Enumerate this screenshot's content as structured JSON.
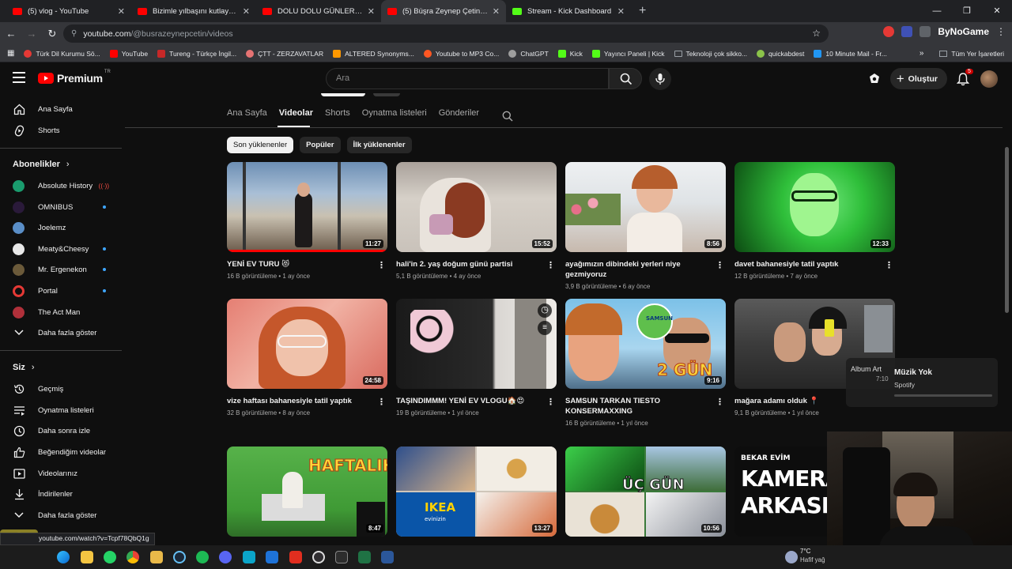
{
  "browser": {
    "tabs": [
      {
        "title": "(5) vlog - YouTube",
        "color": "#ff0000",
        "active": false
      },
      {
        "title": "Bizimle yılbaşını kutlayın! 🎄 | Y",
        "color": "#ff0000",
        "active": false
      },
      {
        "title": "DOLU DOLU GÜNLER| tip fakült",
        "color": "#ff0000",
        "active": false
      },
      {
        "title": "(5) Büşra Zeynep Çetin - YouTu",
        "color": "#ff0000",
        "active": true
      },
      {
        "title": "Stream - Kick Dashboard",
        "color": "#53fc18",
        "active": false
      }
    ],
    "url_host": "youtube.com",
    "url_path": "/@busrazeynepcetin/videos",
    "extension_label": "ByNoGame",
    "bookmarks": [
      {
        "label": "Türk Dil Kurumu Sö...",
        "color": "#e53935"
      },
      {
        "label": "YouTube",
        "color": "#ff0000"
      },
      {
        "label": "Tureng - Türkçe İngil...",
        "color": "#c62828"
      },
      {
        "label": "ÇTT - ZERZAVATLAR",
        "color": "#e57373"
      },
      {
        "label": "ALTERED Synonyms...",
        "color": "#ff9800"
      },
      {
        "label": "Youtube to MP3 Co...",
        "color": "#ff5722"
      },
      {
        "label": "ChatGPT",
        "color": "#9e9e9e"
      },
      {
        "label": "Kick",
        "color": "#53fc18"
      },
      {
        "label": "Yayıncı Paneli | Kick",
        "color": "#53fc18"
      },
      {
        "label": "Teknoloji çok sikko...",
        "color": "#9e9e9e"
      },
      {
        "label": "quickabdest",
        "color": "#8bc34a"
      },
      {
        "label": "10 Minute Mail - Fr...",
        "color": "#2196f3"
      }
    ],
    "all_bookmarks": "Tüm Yer İşaretleri",
    "status_url": "youtube.com/watch?v=Tcpf78QbQ1g"
  },
  "youtube": {
    "logo_text": "Premium",
    "logo_sup": "TR",
    "search_placeholder": "Ara",
    "create_label": "Oluştur",
    "notif_count": "5"
  },
  "sidebar": {
    "main": [
      {
        "label": "Ana Sayfa",
        "icon": "home-icon"
      },
      {
        "label": "Shorts",
        "icon": "shorts-icon"
      }
    ],
    "subs_header": "Abonelikler",
    "subs": [
      {
        "label": "Absolute History",
        "color": "#1a9c6e",
        "badge": "live"
      },
      {
        "label": "OMNIBUS",
        "color": "#2a1a3a",
        "badge": "dot"
      },
      {
        "label": "Joelemz",
        "color": "#5a8ec7",
        "badge": ""
      },
      {
        "label": "Meaty&Cheesy",
        "color": "#e8e8e8",
        "badge": "dot"
      },
      {
        "label": "Mr. Ergenekon",
        "color": "#6b5a3a",
        "badge": "dot"
      },
      {
        "label": "Portal",
        "color": "#e53935",
        "badge": "dot"
      },
      {
        "label": "The Act Man",
        "color": "#b0303a",
        "badge": ""
      }
    ],
    "subs_more": "Daha fazla göster",
    "you_header": "Siz",
    "you": [
      {
        "label": "Geçmiş",
        "icon": "history-icon"
      },
      {
        "label": "Oynatma listeleri",
        "icon": "playlists-icon"
      },
      {
        "label": "Daha sonra izle",
        "icon": "watch-later-icon"
      },
      {
        "label": "Beğendiğim videolar",
        "icon": "like-icon"
      },
      {
        "label": "Videolarınız",
        "icon": "your-videos-icon"
      },
      {
        "label": "İndirilenler",
        "icon": "download-icon"
      }
    ],
    "you_more": "Daha fazla göster"
  },
  "channel": {
    "tabs": [
      "Ana Sayfa",
      "Videolar",
      "Shorts",
      "Oynatma listeleri",
      "Gönderiler"
    ],
    "active_tab": "Videolar",
    "chips": [
      "Son yüklenenler",
      "Popüler",
      "İlk yüklenenler"
    ]
  },
  "videos": [
    {
      "title": "YENİ EV TURU 😻",
      "views": "16 B görüntüleme",
      "age": "1 ay önce",
      "duration": "11:27",
      "progress": 1.0
    },
    {
      "title": "hali'in 2. yaş doğum günü partisi",
      "views": "5,1 B görüntüleme",
      "age": "4 ay önce",
      "duration": "15:52",
      "progress": 0
    },
    {
      "title": "ayağımızın dibindeki yerleri niye gezmiyoruz",
      "views": "3,9 B görüntüleme",
      "age": "6 ay önce",
      "duration": "8:56",
      "progress": 0
    },
    {
      "title": "davet bahanesiyle tatil yaptık",
      "views": "12 B görüntüleme",
      "age": "7 ay önce",
      "duration": "12:33",
      "progress": 0
    },
    {
      "title": "vize haftası bahanesiyle tatil yaptık",
      "views": "32 B görüntüleme",
      "age": "8 ay önce",
      "duration": "24:58",
      "progress": 0
    },
    {
      "title": "TAŞINDIMMM! YENİ EV VLOGU🏠😍",
      "views": "19 B görüntüleme",
      "age": "1 yıl önce",
      "duration": "",
      "progress": 0
    },
    {
      "title": "SAMSUN TARKAN TIESTO KONSERMAXXING",
      "views": "16 B görüntüleme",
      "age": "1 yıl önce",
      "duration": "9:16",
      "progress": 0
    },
    {
      "title": "mağara adamı olduk 📍",
      "views": "9,1 B görüntüleme",
      "age": "1 yıl önce",
      "duration": "",
      "progress": 0
    },
    {
      "title": "",
      "views": "",
      "age": "",
      "duration": "8:47",
      "progress": 0
    },
    {
      "title": "",
      "views": "",
      "age": "",
      "duration": "13:27",
      "progress": 0
    },
    {
      "title": "",
      "views": "",
      "age": "",
      "duration": "10:56",
      "progress": 0
    },
    {
      "title": "",
      "views": "",
      "age": "",
      "duration": "",
      "progress": 0
    }
  ],
  "thumb_texts": {
    "v7_big": "2 GÜN",
    "v7_small": "SAMSUN",
    "v9": "HAFTALIK",
    "v10_ikea": "IKEA",
    "v10_sub": "evinizin",
    "v11": "ÜÇ GÜN",
    "v12_top": "BEKAR EVİM",
    "v12_l1": "KAMERA",
    "v12_l2": "ARKASI"
  },
  "spotify": {
    "art": "Album Art",
    "title": "Müzik Yok",
    "source": "Spotify",
    "time": "7:10"
  },
  "weather": {
    "temp": "7°C",
    "desc": "Hafif yağ"
  }
}
